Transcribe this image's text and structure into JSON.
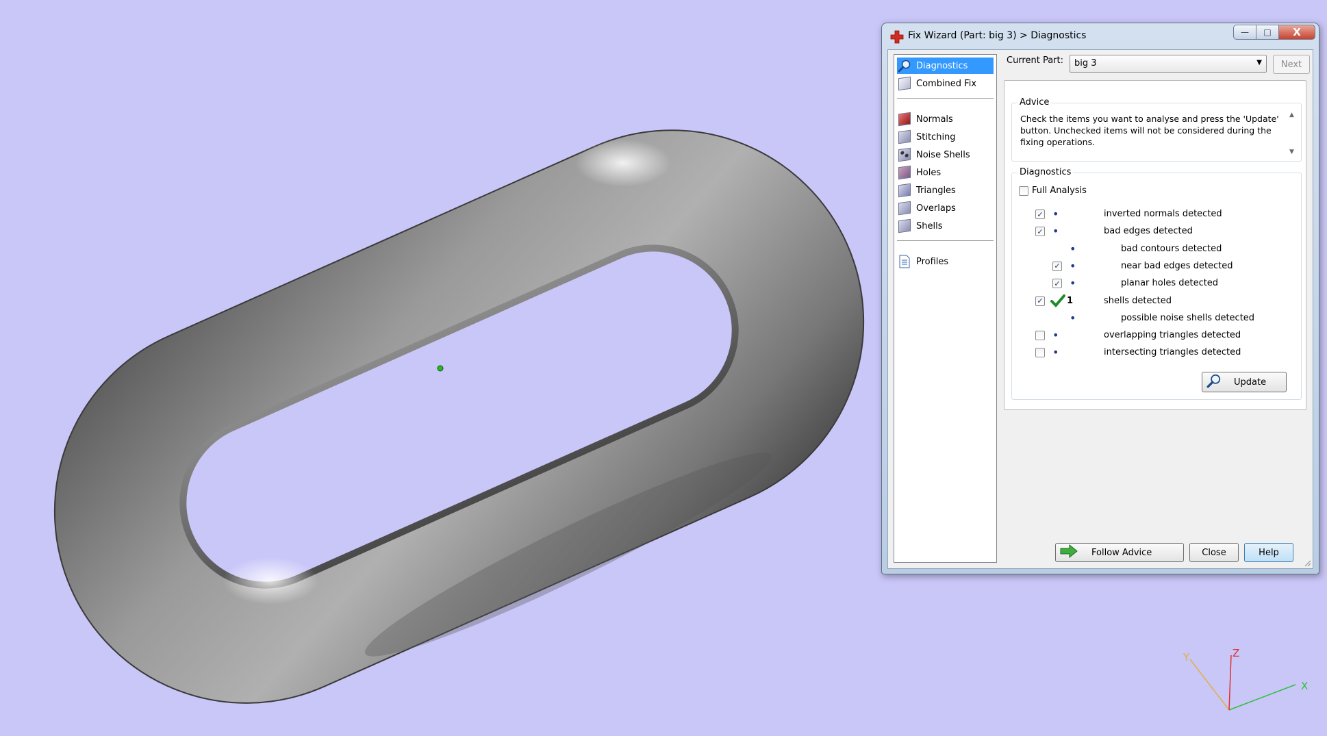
{
  "window": {
    "title": "Fix Wizard (Part: big 3) > Diagnostics",
    "controls": {
      "minimize": "—",
      "maximize": "□",
      "close": "X"
    }
  },
  "nav": {
    "top": [
      {
        "label": "Diagnostics",
        "icon": "magnifier-icon",
        "active": true
      },
      {
        "label": "Combined Fix",
        "icon": "cube-icon"
      }
    ],
    "fixes": [
      {
        "label": "Normals",
        "icon": "normals-cube-icon"
      },
      {
        "label": "Stitching",
        "icon": "stitching-cube-icon"
      },
      {
        "label": "Noise Shells",
        "icon": "noise-shells-icon"
      },
      {
        "label": "Holes",
        "icon": "holes-cube-icon"
      },
      {
        "label": "Triangles",
        "icon": "triangles-cube-icon"
      },
      {
        "label": "Overlaps",
        "icon": "overlaps-cube-icon"
      },
      {
        "label": "Shells",
        "icon": "shells-cube-icon"
      }
    ],
    "bottom": [
      {
        "label": "Profiles",
        "icon": "document-icon"
      }
    ]
  },
  "current_part": {
    "label": "Current Part:",
    "value": "big 3",
    "next_label": "Next"
  },
  "advice": {
    "title": "Advice",
    "text": "Check the items you want to analyse and press the 'Update' button. Unchecked items will not be considered during the fixing operations."
  },
  "diagnostics": {
    "title": "Diagnostics",
    "full_analysis": {
      "label": "Full Analysis",
      "checked": false
    },
    "rows": [
      {
        "label": "inverted normals detected",
        "checked": true,
        "has_checkbox": true,
        "indent": 0,
        "status": "•"
      },
      {
        "label": "bad edges detected",
        "checked": true,
        "has_checkbox": true,
        "indent": 0,
        "status": "•"
      },
      {
        "label": "bad contours detected",
        "checked": false,
        "has_checkbox": false,
        "indent": 1,
        "status": "•"
      },
      {
        "label": "near bad edges detected",
        "checked": true,
        "has_checkbox": true,
        "indent": 1,
        "status": "•"
      },
      {
        "label": "planar holes detected",
        "checked": true,
        "has_checkbox": true,
        "indent": 1,
        "status": "•"
      },
      {
        "label": "shells detected",
        "checked": true,
        "has_checkbox": true,
        "indent": 0,
        "status": "ok",
        "count": "1"
      },
      {
        "label": "possible noise shells detected",
        "checked": false,
        "has_checkbox": false,
        "indent": 1,
        "status": "•"
      },
      {
        "label": "overlapping triangles detected",
        "checked": false,
        "has_checkbox": true,
        "indent": 0,
        "status": "•"
      },
      {
        "label": "intersecting triangles detected",
        "checked": false,
        "has_checkbox": true,
        "indent": 0,
        "status": "•"
      }
    ],
    "update_label": "Update"
  },
  "buttons": {
    "follow_advice": "Follow Advice",
    "close": "Close",
    "help": "Help"
  },
  "axes": {
    "x": "X",
    "y": "Y",
    "z": "Z"
  },
  "colors": {
    "background": "#c9c6f8",
    "selection": "#3399ff",
    "axis_x": "#2fbf3f",
    "axis_y": "#e0b040",
    "axis_z": "#e03030"
  }
}
